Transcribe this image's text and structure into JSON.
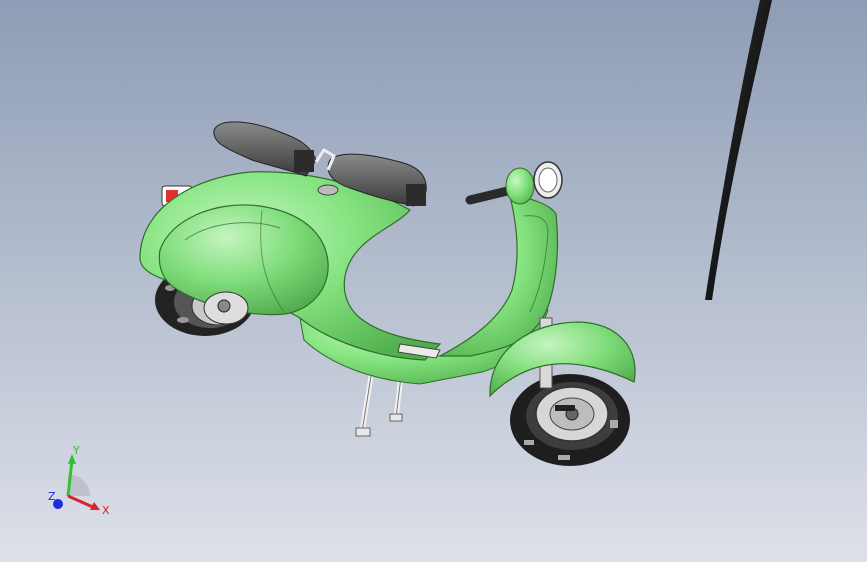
{
  "viewport": {
    "background_top": "#8e9cb5",
    "background_bottom": "#d9dde6",
    "model_color": "#7ee07a",
    "model_shade": "#4fae4b",
    "model_highlight": "#c8f7c4"
  },
  "triad": {
    "x_label": "X",
    "y_label": "Y",
    "z_label": "Z",
    "x_color": "#e0202a",
    "y_color": "#2ec42e",
    "z_color": "#1a2ee0"
  }
}
